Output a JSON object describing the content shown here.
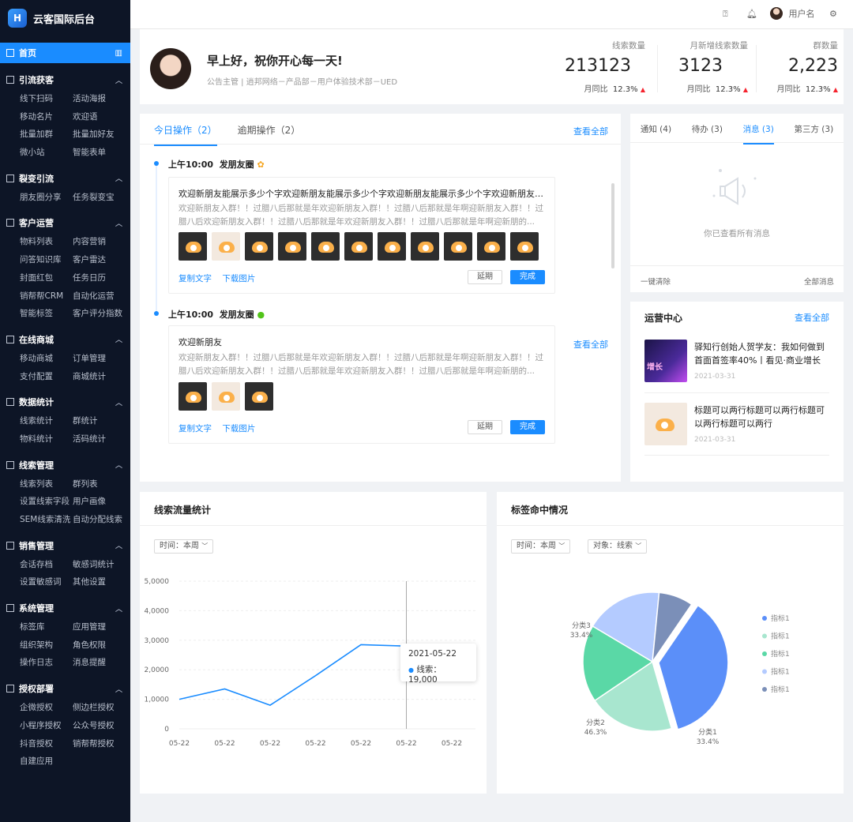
{
  "app": {
    "title": "云客国际后台"
  },
  "topbar": {
    "help_icon": "help-icon",
    "bell_icon": "bell-icon",
    "username": "用户名",
    "settings_icon": "gear-icon"
  },
  "sidebar": {
    "home": "首页",
    "groups": [
      {
        "title": "引流获客",
        "items": [
          "线下扫码",
          "活动海报",
          "移动名片",
          "欢迎语",
          "批量加群",
          "批量加好友",
          "微小站",
          "智能表单"
        ]
      },
      {
        "title": "裂变引流",
        "items": [
          "朋友圈分享",
          "任务裂变宝"
        ]
      },
      {
        "title": "客户运营",
        "items": [
          "物料列表",
          "内容营销",
          "问答知识库",
          "客户雷达",
          "封面红包",
          "任务日历",
          "销帮帮CRM",
          "自动化运营",
          "智能标签",
          "客户评分指数"
        ]
      },
      {
        "title": "在线商城",
        "items": [
          "移动商城",
          "订单管理",
          "支付配置",
          "商城统计"
        ]
      },
      {
        "title": "数据统计",
        "items": [
          "线索统计",
          "群统计",
          "物料统计",
          "活码统计"
        ]
      },
      {
        "title": "线索管理",
        "items": [
          "线索列表",
          "群列表",
          "设置线索字段",
          "用户画像",
          "SEM线索清洗",
          "自动分配线索"
        ]
      },
      {
        "title": "销售管理",
        "items": [
          "会话存档",
          "敏感词统计",
          "设置敏感词",
          "其他设置"
        ]
      },
      {
        "title": "系统管理",
        "items": [
          "标签库",
          "应用管理",
          "组织架构",
          "角色权限",
          "操作日志",
          "消息提醒"
        ]
      },
      {
        "title": "授权部署",
        "items": [
          "企微授权",
          "侧边栏授权",
          "小程序授权",
          "公众号授权",
          "抖音授权",
          "销帮帮授权",
          "自建应用"
        ]
      }
    ]
  },
  "welcome": {
    "greeting": "早上好，祝你开心每一天!",
    "subtitle": "公告主管 | 逍邦网络－产品部－用户体验技术部－UED",
    "stats": [
      {
        "label": "线索数量",
        "value": "213123",
        "compare_label": "月同比",
        "compare_value": "12.3%"
      },
      {
        "label": "月新增线索数量",
        "value": "3123",
        "compare_label": "月同比",
        "compare_value": "12.3%"
      },
      {
        "label": "群数量",
        "value": "2,223",
        "compare_label": "月同比",
        "compare_value": "12.3%"
      }
    ]
  },
  "ops": {
    "tab_today": "今日操作（2）",
    "tab_overdue": "逾期操作（2）",
    "view_all": "查看全部",
    "view_all_2": "查看全部",
    "items": [
      {
        "time": "上午10:00",
        "type": "发朋友圈",
        "title": "欢迎新朋友能展示多少个字欢迎新朋友能展示多少个字欢迎新朋友能展示多少个字欢迎新朋友能展...",
        "body": "欢迎新朋友入群！！过腊八后那就是年欢迎新朋友入群！！过腊八后那就是年啊迎新朋友入群！！过腊八后欢迎新朋友入群！！过腊八后那就是年欢迎新朋友入群！！过腊八后那就是年啊迎新朋的...",
        "copy": "复制文字",
        "download": "下载图片",
        "delay": "延期",
        "done": "完成"
      },
      {
        "time": "上午10:00",
        "type": "发朋友圈",
        "title": "欢迎新朋友",
        "body": "欢迎新朋友入群！！过腊八后那就是年欢迎新朋友入群！！过腊八后那就是年啊迎新朋友入群！！过腊八后欢迎新朋友入群！！过腊八后那就是年欢迎新朋友入群！！过腊八后那就是年啊迎新朋的...",
        "copy": "复制文字",
        "download": "下载图片",
        "delay": "延期",
        "done": "完成"
      }
    ]
  },
  "notify": {
    "tabs": [
      "通知 (4)",
      "待办 (3)",
      "消息 (3)",
      "第三方 (3)"
    ],
    "empty_text": "你已查看所有消息",
    "clear": "一键清除",
    "all": "全部消息"
  },
  "ops_center": {
    "title": "运营中心",
    "view_all": "查看全部",
    "items": [
      {
        "title": "驿知行创始人贺学友：我如何做到首面首签率40%丨看见·商业增长",
        "date": "2021-03-31",
        "badge": "增长"
      },
      {
        "title": "标题可以两行标题可以两行标题可以两行标题可以两行",
        "date": "2021-03-31"
      }
    ]
  },
  "line_chart": {
    "title": "线索流量统计",
    "filter_time": "时间：本周",
    "tooltip_date": "2021-05-22",
    "tooltip_label": "线索：",
    "tooltip_value": "19,000",
    "color": "#1a8cff"
  },
  "pie_chart": {
    "title": "标签命中情况",
    "filter_time": "时间：本周",
    "filter_target": "对象：线索"
  },
  "chart_data": [
    {
      "type": "line",
      "title": "线索流量统计",
      "x": [
        "05-22",
        "05-22",
        "05-22",
        "05-22",
        "05-22",
        "05-22",
        "05-22"
      ],
      "y_ticks": [
        "0",
        "1,0000",
        "2,0000",
        "3,0000",
        "4,0000",
        "5,0000"
      ],
      "ylim": [
        0,
        50000
      ],
      "series": [
        {
          "name": "线索",
          "values": [
            10000,
            13500,
            8000,
            18000,
            28500,
            28000
          ]
        }
      ],
      "grid": true
    },
    {
      "type": "pie",
      "title": "标签命中情况",
      "legend": [
        "指标1",
        "指标1",
        "指标1",
        "指标1",
        "指标1"
      ],
      "legend_placement": "right",
      "slices": [
        {
          "label": "分类1",
          "pct": "33.4%",
          "value": 36,
          "color": "#5b8ff9"
        },
        {
          "label": "分类2",
          "pct": "46.3%",
          "value": 20,
          "color": "#a8e6cf"
        },
        {
          "label": "分类3",
          "pct": "33.4%",
          "value": 18,
          "color": "#5ad8a6"
        },
        {
          "label": "",
          "pct": "",
          "value": 18,
          "color": "#b4cbff"
        },
        {
          "label": "",
          "pct": "",
          "value": 8,
          "color": "#7b8fb8"
        }
      ],
      "legend_colors": [
        "#5b8ff9",
        "#a8e6cf",
        "#5ad8a6",
        "#b4cbff",
        "#7b8fb8"
      ]
    }
  ]
}
